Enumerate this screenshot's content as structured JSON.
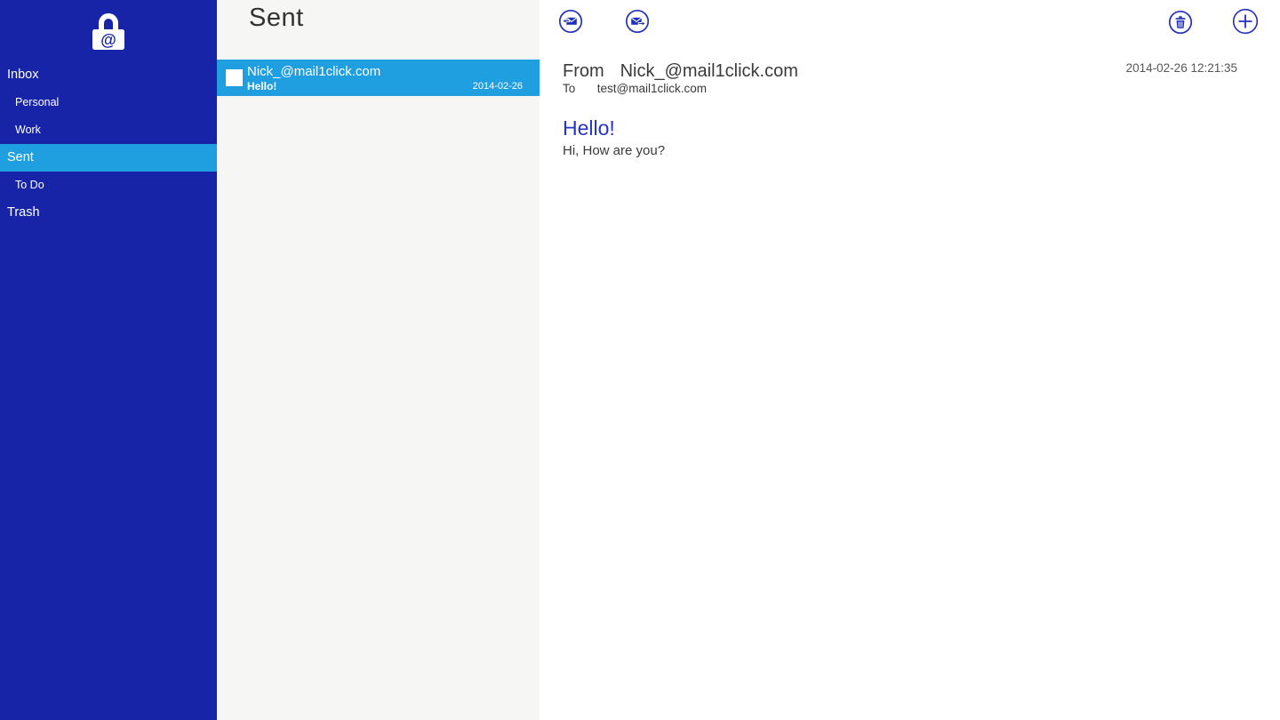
{
  "colors": {
    "sidebar_bg": "#1824a8",
    "accent_selected": "#1f9ee0",
    "list_bg": "#f6f6f5",
    "content_bg": "#ffffff",
    "icon_blue": "#2130b8",
    "subject_blue": "#2433c4",
    "text_dark": "#3a3a3a",
    "text_gray": "#565656"
  },
  "sidebar": {
    "logo_icon": "lock-at-logo",
    "items": [
      {
        "label": "Inbox",
        "indent": 0,
        "selected": false
      },
      {
        "label": "Personal",
        "indent": 1,
        "selected": false
      },
      {
        "label": "Work",
        "indent": 1,
        "selected": false
      },
      {
        "label": "Sent",
        "indent": 0,
        "selected": true
      },
      {
        "label": "To Do",
        "indent": 1,
        "selected": false
      },
      {
        "label": "Trash",
        "indent": 0,
        "selected": false
      }
    ]
  },
  "list": {
    "title": "Sent",
    "emails": [
      {
        "sender": "Nick_@mail1click.com",
        "subject": "Hello!",
        "date": "2014-02-26",
        "selected": true
      }
    ]
  },
  "toolbar": {
    "icons": [
      "reply-icon",
      "forward-icon",
      "delete-icon",
      "new-message-icon"
    ]
  },
  "message": {
    "from_label": "From",
    "from_value": "Nick_@mail1click.com",
    "to_label": "To",
    "to_value": "test@mail1click.com",
    "datetime": "2014-02-26 12:21:35",
    "subject": "Hello!",
    "body": "Hi, How are you?"
  }
}
